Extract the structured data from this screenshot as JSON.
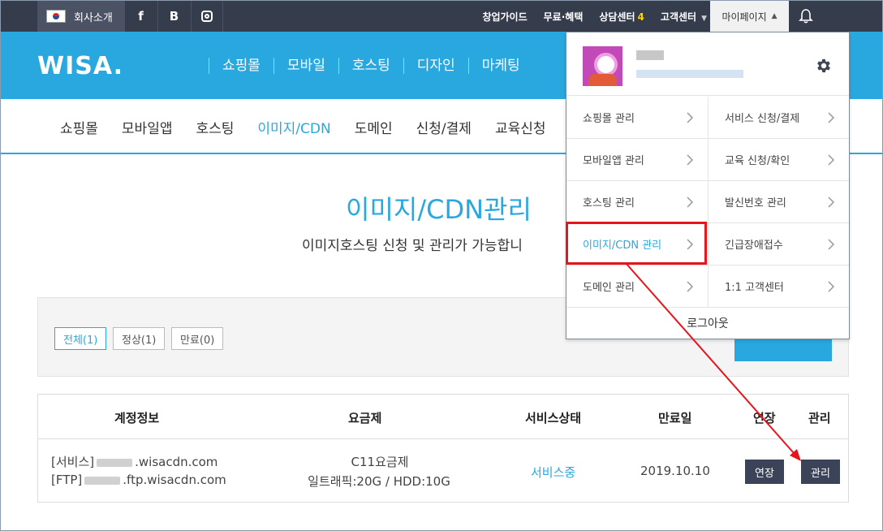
{
  "topbar": {
    "company_label": "회사소개",
    "social": [
      "f",
      "B"
    ],
    "links": {
      "startup_guide": "창업가이드",
      "free_benefits": "무료·혜택",
      "consult_center": "상담센터",
      "consult_count": "4",
      "customer_center": "고객센터"
    },
    "mypage_label": "마이페이지"
  },
  "brand": {
    "logo": "WISA.",
    "main_nav": [
      "쇼핑몰",
      "모바일",
      "호스팅",
      "디자인",
      "마케팅"
    ]
  },
  "subnav": {
    "items": [
      "쇼핑몰",
      "모바일앱",
      "호스팅",
      "이미지/CDN",
      "도메인",
      "신청/결제",
      "교육신청"
    ],
    "active_index": 3
  },
  "page": {
    "title": "이미지/CDN관리",
    "description": "이미지호스팅 신청 및 관리가 가능합니"
  },
  "filters": [
    "전체(1)",
    "정상(1)",
    "만료(0)"
  ],
  "table": {
    "headers": [
      "계정정보",
      "요금제",
      "서비스상태",
      "만료일",
      "연장",
      "관리"
    ],
    "row": {
      "service_prefix": "[서비스]",
      "service_domain": ".wisacdn.com",
      "ftp_prefix": "[FTP]",
      "ftp_domain": ".ftp.wisacdn.com",
      "plan_name": "C11요금제",
      "plan_detail": "일트래픽:20G / HDD:10G",
      "status": "서비스중",
      "expiry": "2019.10.10",
      "extend_button": "연장",
      "manage_button": "관리"
    }
  },
  "dropdown": {
    "items": [
      {
        "label": "쇼핑몰 관리"
      },
      {
        "label": "서비스 신청/결제"
      },
      {
        "label": "모바일앱 관리"
      },
      {
        "label": "교육 신청/확인"
      },
      {
        "label": "호스팅 관리"
      },
      {
        "label": "발신번호 관리"
      },
      {
        "label": "이미지/CDN 관리"
      },
      {
        "label": "긴급장애접수"
      },
      {
        "label": "도메인 관리"
      },
      {
        "label": "1:1 고객센터"
      }
    ],
    "logout": "로그아웃"
  },
  "colors": {
    "accent": "#29a8e0",
    "topbar": "#353c4c",
    "annotation_red": "#e8141b",
    "dark_button": "#3a4357"
  }
}
